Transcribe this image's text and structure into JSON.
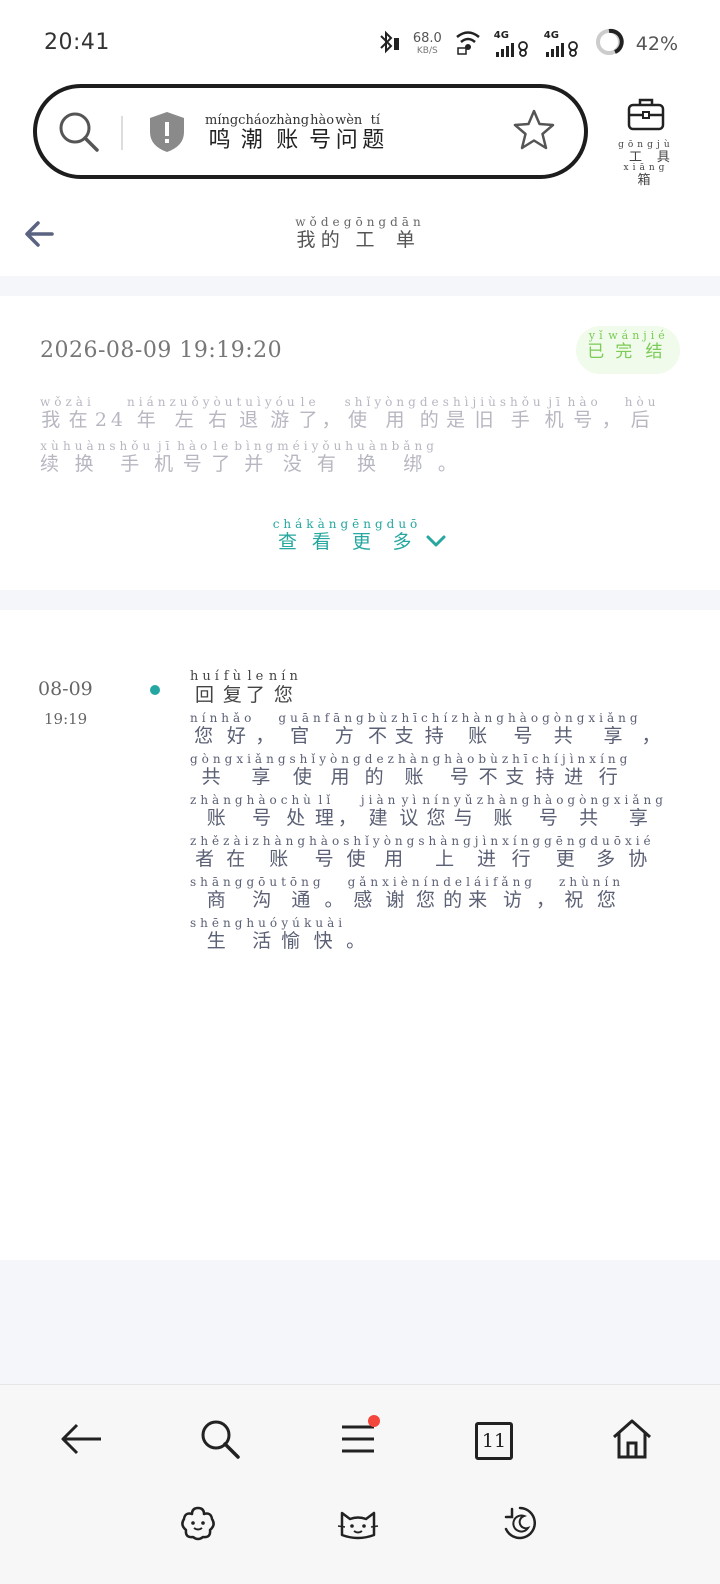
{
  "status_bar": {
    "time": "20:41",
    "net_speed": "68.0",
    "net_unit": "KB/S",
    "signal_1": "4G",
    "signal_2": "4G",
    "battery": "42%"
  },
  "search": {
    "query": [
      {
        "c": "鸣",
        "p": "míng"
      },
      {
        "c": "潮",
        "p": "cháo"
      },
      {
        "c": "账",
        "p": "zhàng"
      },
      {
        "c": "号",
        "p": "hào"
      },
      {
        "c": "问",
        "p": "wèn"
      },
      {
        "c": "题",
        "p": "tí"
      }
    ],
    "toolbox_label": [
      {
        "c": "工",
        "p": "gōng"
      },
      {
        "c": "具",
        "p": "jù"
      },
      {
        "c": "箱",
        "p": "xiāng"
      }
    ]
  },
  "header": {
    "title": [
      {
        "c": "我",
        "p": "wǒ"
      },
      {
        "c": "的",
        "p": "de"
      },
      {
        "c": "工",
        "p": "gōng"
      },
      {
        "c": "单",
        "p": "dān"
      }
    ]
  },
  "ticket": {
    "datetime": "2026-08-09 19:19:20",
    "status": [
      {
        "c": "已",
        "p": "yǐ"
      },
      {
        "c": "完",
        "p": "wán"
      },
      {
        "c": "结",
        "p": "jié"
      }
    ],
    "description": [
      {
        "c": "我",
        "p": "wǒ"
      },
      {
        "c": "在",
        "p": "zài"
      },
      {
        "c": "24",
        "p": ""
      },
      {
        "c": "年",
        "p": "nián"
      },
      {
        "c": "左",
        "p": "zuǒ"
      },
      {
        "c": "右",
        "p": "yòu"
      },
      {
        "c": "退",
        "p": "tuì"
      },
      {
        "c": "游",
        "p": "yóu"
      },
      {
        "c": "了",
        "p": "le"
      },
      {
        "c": "，",
        "p": ""
      },
      {
        "c": "使",
        "p": "shǐ"
      },
      {
        "c": "用",
        "p": "yòng"
      },
      {
        "c": "的",
        "p": "de"
      },
      {
        "c": "是",
        "p": "shì"
      },
      {
        "c": "旧",
        "p": "jiù"
      },
      {
        "c": "手",
        "p": "shǒu"
      },
      {
        "c": "机",
        "p": "jī"
      },
      {
        "c": "号",
        "p": "hào"
      },
      {
        "c": "，",
        "p": ""
      },
      {
        "c": "后",
        "p": "hòu"
      },
      {
        "c": "续",
        "p": "xù"
      },
      {
        "c": "换",
        "p": "huàn"
      },
      {
        "c": "手",
        "p": "shǒu"
      },
      {
        "c": "机",
        "p": "jī"
      },
      {
        "c": "号",
        "p": "hào"
      },
      {
        "c": "了",
        "p": "le"
      },
      {
        "c": "并",
        "p": "bìng"
      },
      {
        "c": "没",
        "p": "méi"
      },
      {
        "c": "有",
        "p": "yǒu"
      },
      {
        "c": "换",
        "p": "huàn"
      },
      {
        "c": "绑",
        "p": "bǎng"
      },
      {
        "c": "。",
        "p": ""
      }
    ],
    "view_more": [
      {
        "c": "查",
        "p": "chá"
      },
      {
        "c": "看",
        "p": "kàn"
      },
      {
        "c": "更",
        "p": "gēng"
      },
      {
        "c": "多",
        "p": "duō"
      }
    ]
  },
  "reply": {
    "date": "08-09",
    "time": "19:19",
    "title": [
      {
        "c": "回",
        "p": "huí"
      },
      {
        "c": "复",
        "p": "fù"
      },
      {
        "c": "了",
        "p": "le"
      },
      {
        "c": "您",
        "p": "nín"
      }
    ],
    "body": [
      {
        "c": "您",
        "p": "nín"
      },
      {
        "c": "好",
        "p": "hǎo"
      },
      {
        "c": "，",
        "p": ""
      },
      {
        "c": "官",
        "p": "guān"
      },
      {
        "c": "方",
        "p": "fāng"
      },
      {
        "c": "不",
        "p": "bù"
      },
      {
        "c": "支",
        "p": "zhī"
      },
      {
        "c": "持",
        "p": "chí"
      },
      {
        "c": "账",
        "p": "zhàng"
      },
      {
        "c": "号",
        "p": "hào"
      },
      {
        "c": "共",
        "p": "gòng"
      },
      {
        "c": "享",
        "p": "xiǎng"
      },
      {
        "c": "，",
        "p": ""
      },
      {
        "c": "共",
        "p": "gòng"
      },
      {
        "c": "享",
        "p": "xiǎng"
      },
      {
        "c": "使",
        "p": "shǐ"
      },
      {
        "c": "用",
        "p": "yòng"
      },
      {
        "c": "的",
        "p": "de"
      },
      {
        "c": "账",
        "p": "zhàng"
      },
      {
        "c": "号",
        "p": "hào"
      },
      {
        "c": "不",
        "p": "bù"
      },
      {
        "c": "支",
        "p": "zhī"
      },
      {
        "c": "持",
        "p": "chí"
      },
      {
        "c": "进",
        "p": "jìn"
      },
      {
        "c": "行",
        "p": "xíng"
      },
      {
        "c": "账",
        "p": "zhàng"
      },
      {
        "c": "号",
        "p": "hào"
      },
      {
        "c": "处",
        "p": "chù"
      },
      {
        "c": "理",
        "p": "lǐ"
      },
      {
        "c": "，",
        "p": ""
      },
      {
        "c": "建",
        "p": "jiàn"
      },
      {
        "c": "议",
        "p": "yì"
      },
      {
        "c": "您",
        "p": "nín"
      },
      {
        "c": "与",
        "p": "yǔ"
      },
      {
        "c": "账",
        "p": "zhàng"
      },
      {
        "c": "号",
        "p": "hào"
      },
      {
        "c": "共",
        "p": "gòng"
      },
      {
        "c": "享",
        "p": "xiǎng"
      },
      {
        "c": "者",
        "p": "zhě"
      },
      {
        "c": "在",
        "p": "zài"
      },
      {
        "c": "账",
        "p": "zhàng"
      },
      {
        "c": "号",
        "p": "hào"
      },
      {
        "c": "使",
        "p": "shǐ"
      },
      {
        "c": "用",
        "p": "yòng"
      },
      {
        "c": "上",
        "p": "shàng"
      },
      {
        "c": "进",
        "p": "jìn"
      },
      {
        "c": "行",
        "p": "xíng"
      },
      {
        "c": "更",
        "p": "gēng"
      },
      {
        "c": "多",
        "p": "duō"
      },
      {
        "c": "协",
        "p": "xié"
      },
      {
        "c": "商",
        "p": "shāng"
      },
      {
        "c": "沟",
        "p": "gōu"
      },
      {
        "c": "通",
        "p": "tōng"
      },
      {
        "c": "。",
        "p": ""
      },
      {
        "c": "感",
        "p": "gǎn"
      },
      {
        "c": "谢",
        "p": "xiè"
      },
      {
        "c": "您",
        "p": "nín"
      },
      {
        "c": "的",
        "p": "de"
      },
      {
        "c": "来",
        "p": "lái"
      },
      {
        "c": "访",
        "p": "fǎng"
      },
      {
        "c": "，",
        "p": ""
      },
      {
        "c": "祝",
        "p": "zhù"
      },
      {
        "c": "您",
        "p": "nín"
      },
      {
        "c": "生",
        "p": "shēng"
      },
      {
        "c": "活",
        "p": "huó"
      },
      {
        "c": "愉",
        "p": "yú"
      },
      {
        "c": "快",
        "p": "kuài"
      },
      {
        "c": "。",
        "p": ""
      }
    ]
  },
  "bottom_nav": {
    "tab_count": "11"
  },
  "icons": {
    "search": "search-icon",
    "shield": "shield-icon",
    "star": "star-icon",
    "toolbox": "toolbox-icon",
    "back": "back-arrow-icon",
    "chevron": "chevron-down-icon",
    "menu": "menu-icon",
    "home": "home-icon",
    "flower": "flower-icon",
    "cat": "cat-icon",
    "night": "moon-icon"
  },
  "colors": {
    "accent_teal": "#26a7a0",
    "status_green": "#7bcb55",
    "badge_red": "#f4463b"
  }
}
